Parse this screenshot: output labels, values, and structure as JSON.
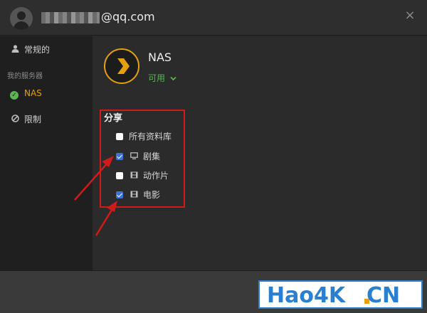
{
  "header": {
    "email_suffix": "@qq.com",
    "close_label": "×"
  },
  "sidebar": {
    "general_label": "常规的",
    "section_label": "我的服务器",
    "server_label": "NAS",
    "restrict_label": "限制"
  },
  "server": {
    "name": "NAS",
    "status": "可用"
  },
  "share": {
    "title": "分享",
    "libraries": [
      {
        "label": "所有资料库",
        "checked": false,
        "icon": ""
      },
      {
        "label": "剧集",
        "checked": true,
        "icon": "tv-icon"
      },
      {
        "label": "动作片",
        "checked": false,
        "icon": "film-icon"
      },
      {
        "label": "电影",
        "checked": true,
        "icon": "film-icon"
      }
    ]
  },
  "watermark": {
    "left": "Hao4K",
    "right": "CN"
  },
  "colors": {
    "accent": "#e5a00d",
    "status_green": "#5ab552",
    "checkbox_blue": "#3b73d6",
    "annotation_red": "#d11a1a",
    "watermark_blue": "#2b7fd0"
  }
}
